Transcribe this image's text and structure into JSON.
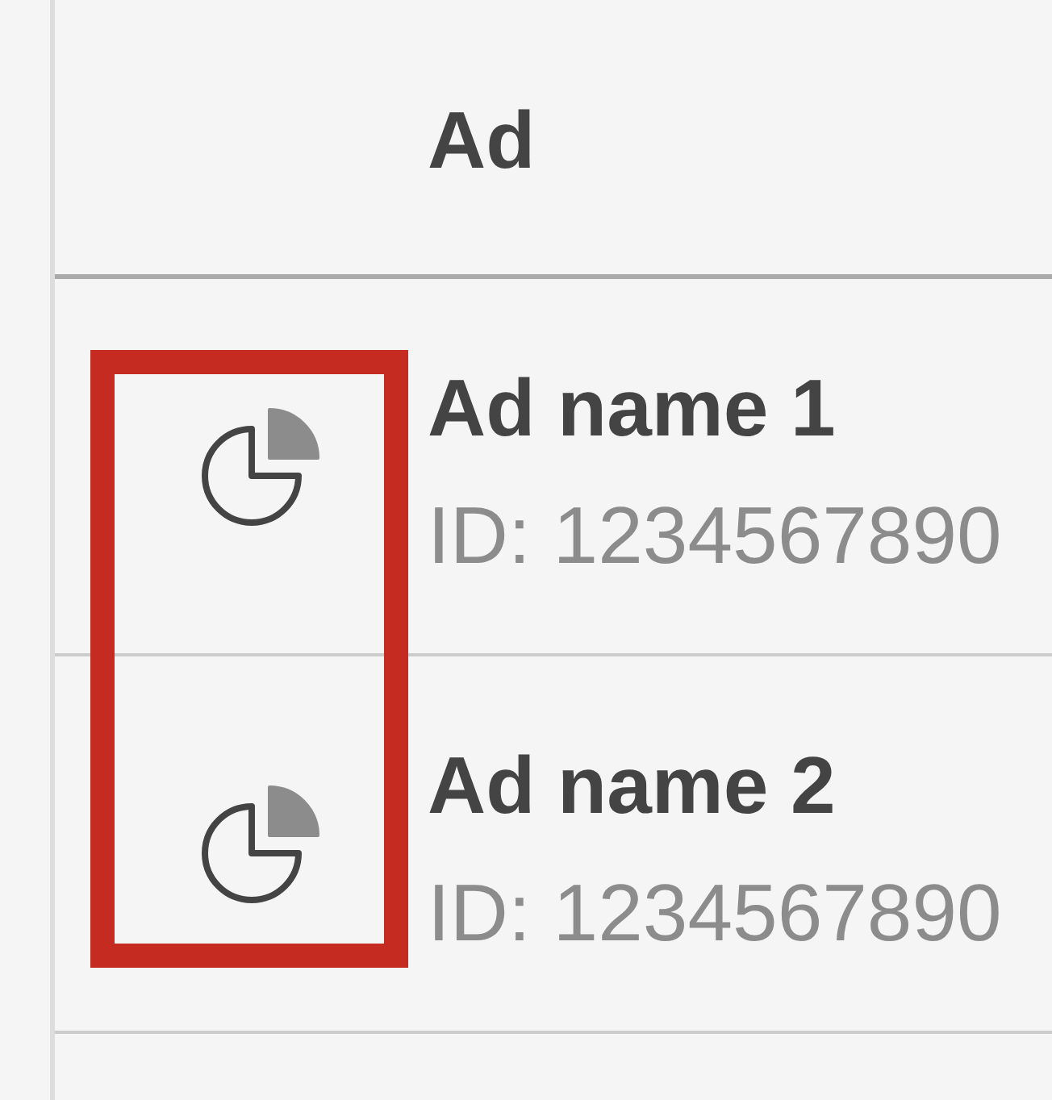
{
  "table": {
    "header": "Ad",
    "icon_column_highlighted": true,
    "rows": [
      {
        "name": "Ad name 1",
        "id": "ID: 1234567890"
      },
      {
        "name": "Ad name 2",
        "id": "ID: 1234567890"
      }
    ]
  }
}
